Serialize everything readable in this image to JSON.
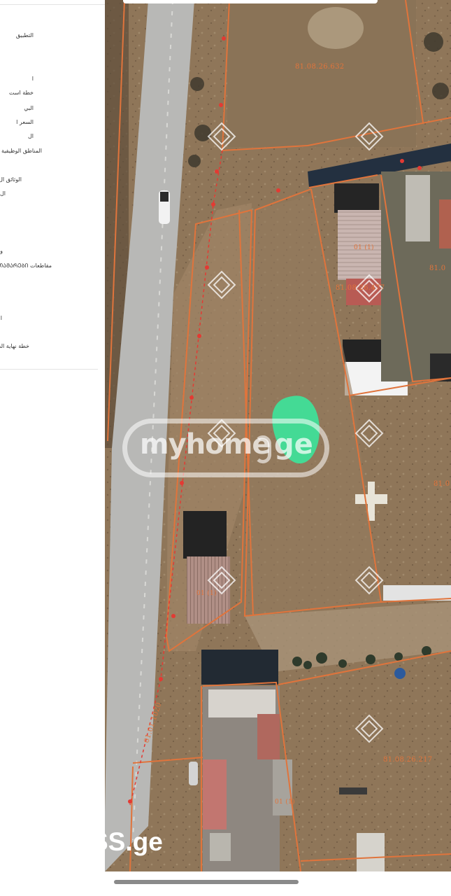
{
  "side_panel": {
    "items": [
      "التطبيق",
      "ا",
      "خطة است",
      "البي",
      "السعر ا",
      "ال",
      "المناطق الوظيفية و",
      "الوثائق ال",
      "ال",
      "و",
      "مقاطعات ᲗᲐᲛᲐᲠᲔᲑᲘ",
      "ا",
      "خطة نهاية الحياة"
    ]
  },
  "map": {
    "parcel_labels": [
      "81.08.26.632",
      "01 (1)",
      "81.08.26.477",
      "81.0",
      "81.0",
      "01 (1)",
      "01.01.1020",
      "81.08.26.217",
      "01 (1)"
    ]
  },
  "watermark": {
    "text": "myhome",
    "suffix": "ge"
  },
  "logo": {
    "text": "SS.ge"
  },
  "colors": {
    "parcel_line": "#e0743c",
    "location_marker": "#3ee39a",
    "road": "#b9b9b9",
    "ground": "#8c7458"
  }
}
